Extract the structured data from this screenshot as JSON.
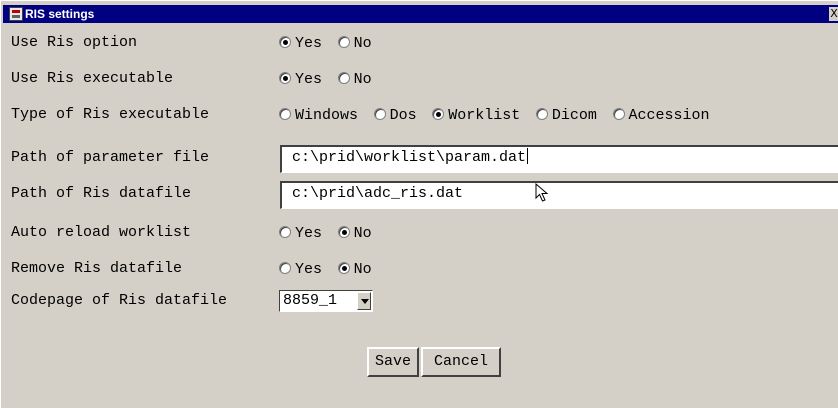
{
  "window": {
    "title": "RIS settings",
    "close_label": "X"
  },
  "settings": {
    "use_ris_option": {
      "label": "Use Ris option",
      "options": [
        "Yes",
        "No"
      ],
      "selected": "Yes"
    },
    "use_ris_executable": {
      "label": "Use Ris executable",
      "options": [
        "Yes",
        "No"
      ],
      "selected": "Yes"
    },
    "type_of_ris_executable": {
      "label": "Type of Ris executable",
      "options": [
        "Windows",
        "Dos",
        "Worklist",
        "Dicom",
        "Accession"
      ],
      "selected": "Worklist"
    },
    "path_parameter_file": {
      "label": "Path of parameter file",
      "value": "c:\\prid\\worklist\\param.dat"
    },
    "path_ris_datafile": {
      "label": "Path of Ris datafile",
      "value": "c:\\prid\\adc_ris.dat"
    },
    "auto_reload_worklist": {
      "label": "Auto reload worklist",
      "options": [
        "Yes",
        "No"
      ],
      "selected": "No"
    },
    "remove_ris_datafile": {
      "label": "Remove Ris datafile",
      "options": [
        "Yes",
        "No"
      ],
      "selected": "No"
    },
    "codepage": {
      "label": "Codepage of Ris datafile",
      "value": "8859_1"
    }
  },
  "buttons": {
    "save": "Save",
    "cancel": "Cancel"
  }
}
